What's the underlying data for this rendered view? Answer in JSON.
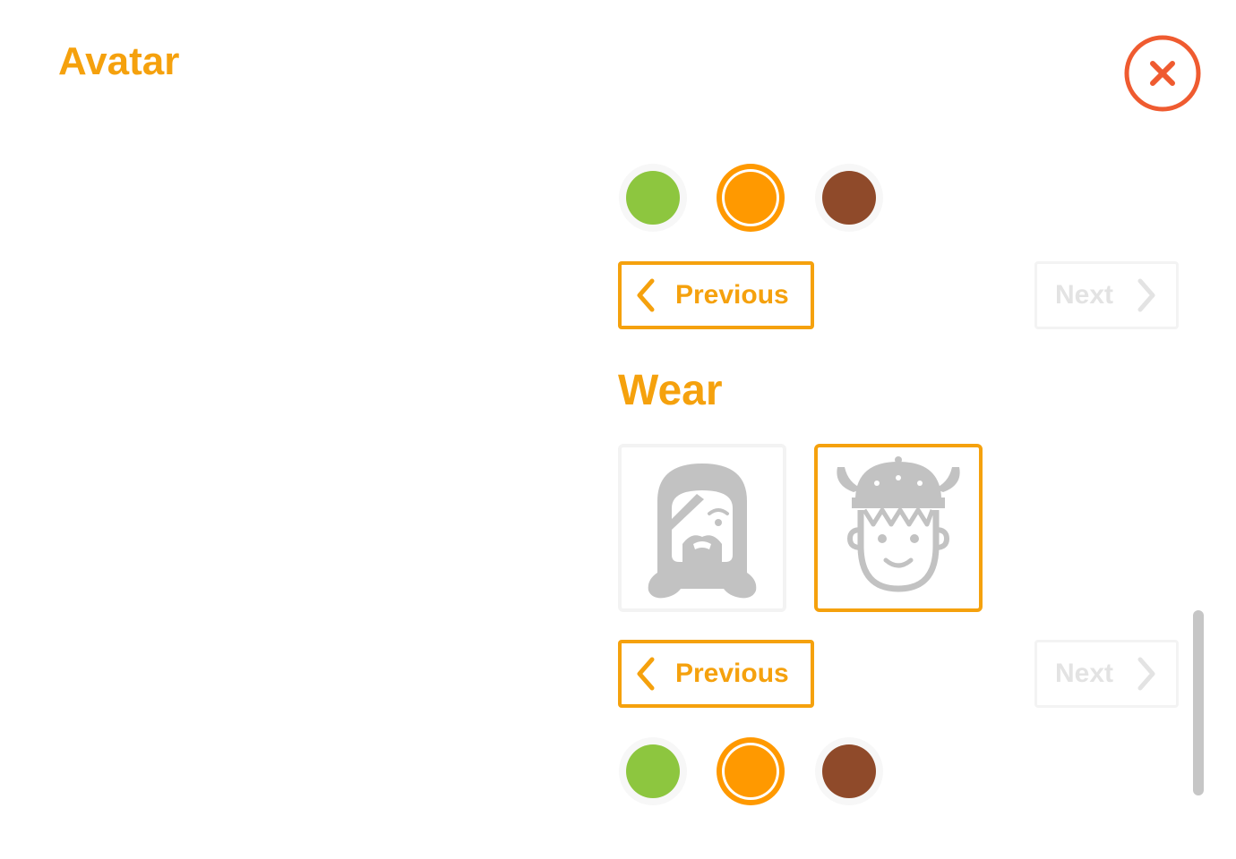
{
  "dialog": {
    "title": "Avatar",
    "close_icon": "close-x-icon",
    "accent_color": "#F5A10D",
    "close_color": "#EF5B30"
  },
  "palette_top": {
    "swatches": [
      {
        "color": "#8DC63F",
        "selected": false
      },
      {
        "color": "#FF9900",
        "selected": true
      },
      {
        "color": "#8F4A2A",
        "selected": false
      }
    ]
  },
  "nav_top": {
    "previous_label": "Previous",
    "next_label": "Next"
  },
  "wear": {
    "title": "Wear",
    "items": [
      {
        "icon": "hooded-bearded-face-icon",
        "selected": false
      },
      {
        "icon": "viking-helmet-face-icon",
        "selected": true
      }
    ]
  },
  "nav_bottom": {
    "previous_label": "Previous",
    "next_label": "Next"
  },
  "palette_bottom": {
    "swatches": [
      {
        "color": "#8DC63F",
        "selected": false
      },
      {
        "color": "#FF9900",
        "selected": true
      },
      {
        "color": "#8F4A2A",
        "selected": false
      }
    ]
  }
}
